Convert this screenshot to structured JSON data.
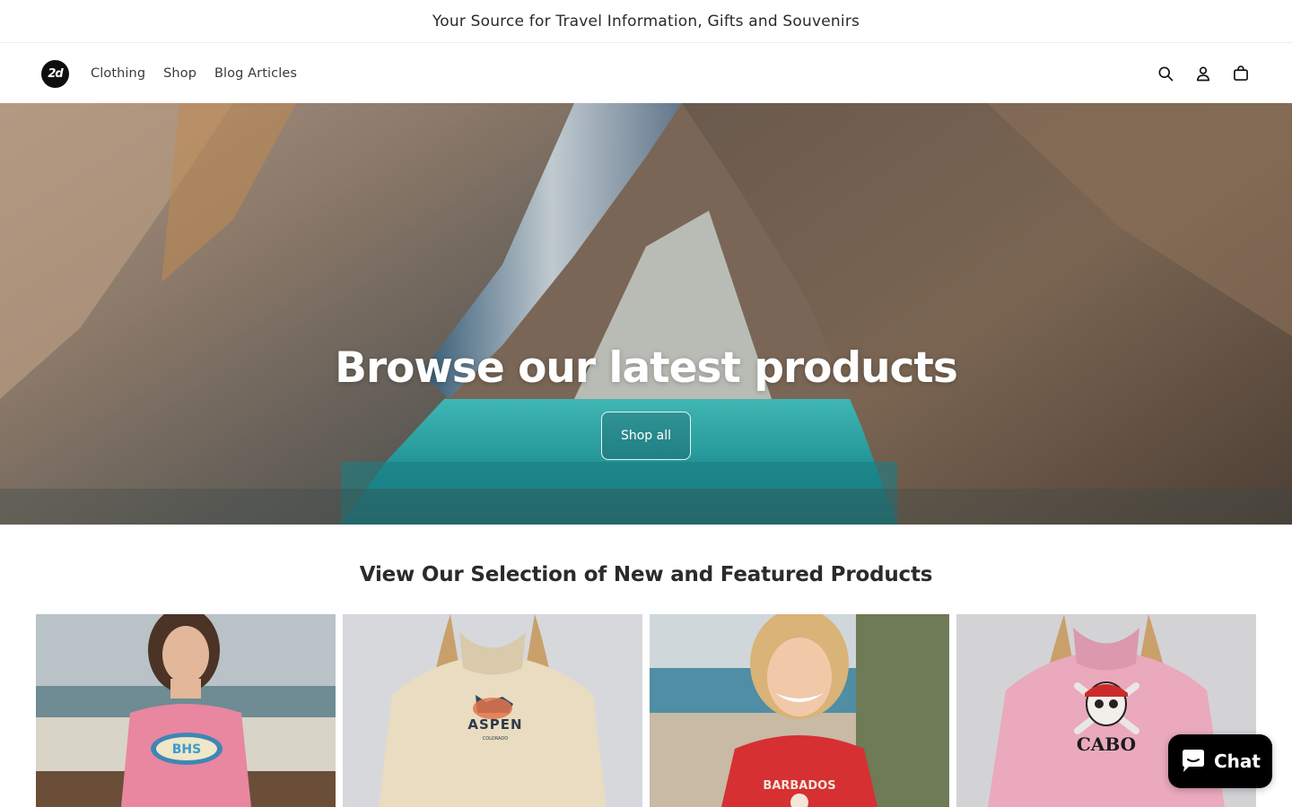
{
  "announcement": "Your Source for Travel Information, Gifts and Souvenirs",
  "header": {
    "logo_text": "2d",
    "nav": [
      "Clothing",
      "Shop",
      "Blog Articles"
    ],
    "icons": [
      "search-icon",
      "account-icon",
      "cart-icon"
    ]
  },
  "hero": {
    "title": "Browse our latest products",
    "button_label": "Shop all"
  },
  "featured": {
    "title": "View Our Selection of New and Featured Products",
    "products": [
      {
        "print": "BHS",
        "garment": "pink t-shirt"
      },
      {
        "print": "ASPEN",
        "print_sub": "COLORADO",
        "garment": "cream hoodie"
      },
      {
        "print": "BARBADOS",
        "garment": "red t-shirt"
      },
      {
        "print": "CABO",
        "garment": "pink hoodie"
      }
    ]
  },
  "chat": {
    "label": "Chat"
  },
  "colors": {
    "ink": "#121212",
    "chat_bg": "#000000",
    "hero_water": "#2aa8a8"
  }
}
